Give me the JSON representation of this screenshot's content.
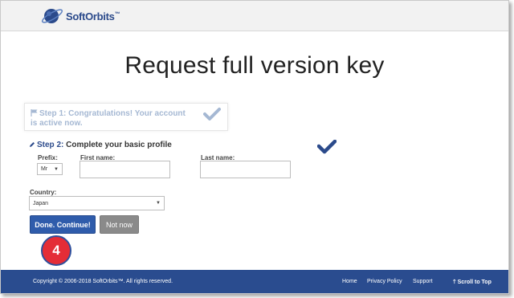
{
  "header": {
    "logo_text": "SoftOrbits",
    "logo_tm": "™"
  },
  "page_title": "Request full version key",
  "step1": {
    "step_label": "Step 1:",
    "text": "Congratulations! Your account is active now."
  },
  "step2": {
    "step_label": "Step 2:",
    "text": "Complete your basic profile",
    "prefix": {
      "label": "Prefix:",
      "value": "Mr"
    },
    "first_name": {
      "label": "First name:",
      "value": ""
    },
    "last_name": {
      "label": "Last name:",
      "value": ""
    },
    "country": {
      "label": "Country:",
      "value": "Japan"
    }
  },
  "buttons": {
    "continue": "Done. Continue!",
    "not_now": "Not now"
  },
  "badge": "4",
  "footer": {
    "copyright": "Copyright © 2006-2018 SoftOrbits™. All rights reserved.",
    "home": "Home",
    "privacy": "Privacy Policy",
    "support": "Support",
    "scroll_top": "Scroll to Top"
  },
  "colors": {
    "brand_blue": "#2a4c8f",
    "badge_red": "#e42d37",
    "check_light": "#a5b8d3",
    "check_dark": "#2b4a8b"
  },
  "icons": [
    "planet-logo-icon",
    "flag-icon",
    "check-icon",
    "pencil-icon",
    "chevron-down-icon",
    "arrow-up-icon"
  ]
}
